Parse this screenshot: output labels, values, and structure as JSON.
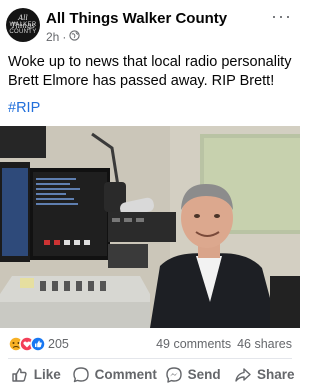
{
  "post": {
    "page_name": "All Things Walker County",
    "time": "2h",
    "time_separator": "·",
    "text": "Woke up to news that local radio personality Brett Elmore has passed away.  RIP Brett!",
    "hashtag": "#RIP",
    "avatar_text": {
      "line1": "All Things",
      "line2": "WALKER",
      "line3": "COUNTY"
    },
    "more_label": "···"
  },
  "engagement": {
    "reaction_icons": [
      "sad-emoji-icon",
      "love-emoji-icon",
      "like-emoji-icon"
    ],
    "reaction_count": "205",
    "comments": "49 comments",
    "shares": "46 shares"
  },
  "actions": {
    "like": "Like",
    "comment": "Comment",
    "send": "Send",
    "share": "Share"
  },
  "colors": {
    "link": "#216fdb",
    "secondary_text": "#65676b",
    "like_blue": "#1877f2",
    "love_red": "#f33e58",
    "sad_yellow": "#f7b125"
  }
}
